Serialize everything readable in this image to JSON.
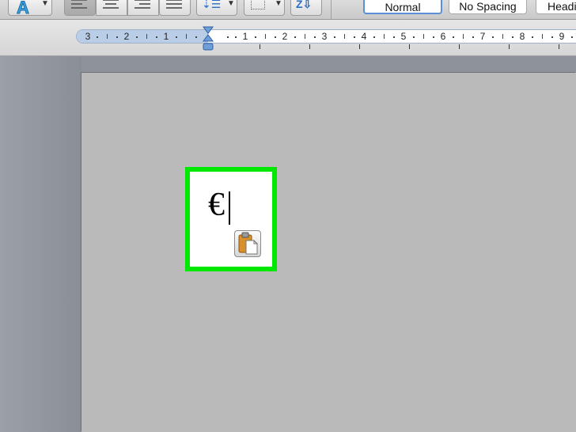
{
  "toolbar": {
    "font_color_glyph": "A",
    "styles": [
      "Normal",
      "No Spacing",
      "Headi"
    ]
  },
  "ruler": {
    "labels": [
      "3",
      "2",
      "1",
      "1",
      "2",
      "3",
      "4",
      "5",
      "6",
      "7",
      "8",
      "9"
    ]
  },
  "document": {
    "text": "€"
  },
  "colors": {
    "highlight": "#00e800",
    "page": "#bababa",
    "ruler_margin": "#b9cde6"
  },
  "icons": {
    "font_color": "font-color-icon",
    "align": "align-icon",
    "line_spacing": "line-spacing-icon",
    "borders": "borders-icon",
    "sort": "sort-icon",
    "paste_options": "clipboard-icon"
  }
}
